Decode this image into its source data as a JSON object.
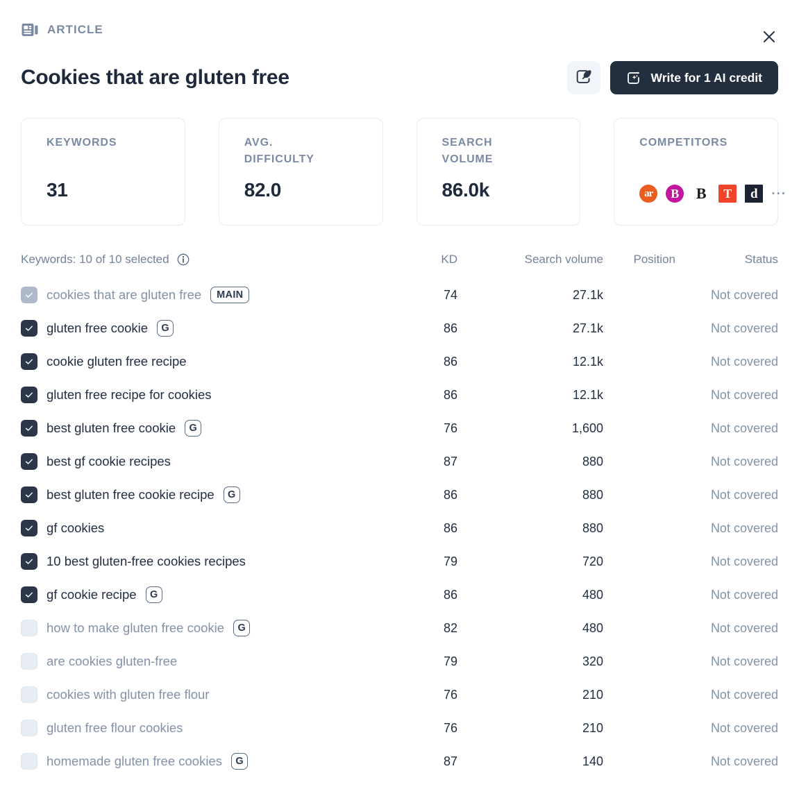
{
  "header": {
    "eyebrow_label": "ARTICLE",
    "eyebrow_icon": "article-icon",
    "close_icon": "close-icon",
    "title": "Cookies that are gluten free"
  },
  "actions": {
    "edit_icon": "quill-pen-icon",
    "ai_icon": "ai-sparkle-icon",
    "write_label": "Write for 1 AI credit"
  },
  "stats": [
    {
      "label": "KEYWORDS",
      "value": "31"
    },
    {
      "label": "AVG. DIFFICULTY",
      "value": "82.0"
    },
    {
      "label": "SEARCH VOLUME",
      "value": "86.0k"
    }
  ],
  "competitors": {
    "label": "COMPETITORS",
    "items": [
      {
        "name": "allrecipes-favicon",
        "text": "ar",
        "class": "fav-ar"
      },
      {
        "name": "bettycrocker-favicon",
        "text": "B",
        "class": "fav-b1"
      },
      {
        "name": "bonappetit-favicon",
        "text": "B",
        "class": "fav-b2"
      },
      {
        "name": "nytimes-favicon",
        "text": "T",
        "class": "fav-t"
      },
      {
        "name": "delish-favicon",
        "text": "d",
        "class": "fav-d"
      }
    ],
    "more": "···"
  },
  "table": {
    "summary": "Keywords: 10 of 10 selected",
    "info_icon": "info-icon",
    "columns": {
      "kd": "KD",
      "volume": "Search volume",
      "position": "Position",
      "status": "Status"
    },
    "rows": [
      {
        "keyword": "cookies that are gluten free",
        "badge": "MAIN",
        "badge_type": "main",
        "checked": true,
        "disabled": true,
        "kd": "74",
        "volume": "27.1k",
        "position": "",
        "status": "Not covered"
      },
      {
        "keyword": "gluten free cookie",
        "badge": "G",
        "badge_type": "g",
        "checked": true,
        "disabled": false,
        "kd": "86",
        "volume": "27.1k",
        "position": "",
        "status": "Not covered"
      },
      {
        "keyword": "cookie gluten free recipe",
        "badge": "",
        "badge_type": "",
        "checked": true,
        "disabled": false,
        "kd": "86",
        "volume": "12.1k",
        "position": "",
        "status": "Not covered"
      },
      {
        "keyword": "gluten free recipe for cookies",
        "badge": "",
        "badge_type": "",
        "checked": true,
        "disabled": false,
        "kd": "86",
        "volume": "12.1k",
        "position": "",
        "status": "Not covered"
      },
      {
        "keyword": "best gluten free cookie",
        "badge": "G",
        "badge_type": "g",
        "checked": true,
        "disabled": false,
        "kd": "76",
        "volume": "1,600",
        "position": "",
        "status": "Not covered"
      },
      {
        "keyword": "best gf cookie recipes",
        "badge": "",
        "badge_type": "",
        "checked": true,
        "disabled": false,
        "kd": "87",
        "volume": "880",
        "position": "",
        "status": "Not covered"
      },
      {
        "keyword": "best gluten free cookie recipe",
        "badge": "G",
        "badge_type": "g",
        "checked": true,
        "disabled": false,
        "kd": "86",
        "volume": "880",
        "position": "",
        "status": "Not covered"
      },
      {
        "keyword": "gf cookies",
        "badge": "",
        "badge_type": "",
        "checked": true,
        "disabled": false,
        "kd": "86",
        "volume": "880",
        "position": "",
        "status": "Not covered"
      },
      {
        "keyword": "10 best gluten-free cookies recipes",
        "badge": "",
        "badge_type": "",
        "checked": true,
        "disabled": false,
        "kd": "79",
        "volume": "720",
        "position": "",
        "status": "Not covered"
      },
      {
        "keyword": "gf cookie recipe",
        "badge": "G",
        "badge_type": "g",
        "checked": true,
        "disabled": false,
        "kd": "86",
        "volume": "480",
        "position": "",
        "status": "Not covered"
      },
      {
        "keyword": "how to make gluten free cookie",
        "badge": "G",
        "badge_type": "g",
        "checked": false,
        "disabled": false,
        "kd": "82",
        "volume": "480",
        "position": "",
        "status": "Not covered"
      },
      {
        "keyword": "are cookies gluten-free",
        "badge": "",
        "badge_type": "",
        "checked": false,
        "disabled": false,
        "kd": "79",
        "volume": "320",
        "position": "",
        "status": "Not covered"
      },
      {
        "keyword": "cookies with gluten free flour",
        "badge": "",
        "badge_type": "",
        "checked": false,
        "disabled": false,
        "kd": "76",
        "volume": "210",
        "position": "",
        "status": "Not covered"
      },
      {
        "keyword": "gluten free flour cookies",
        "badge": "",
        "badge_type": "",
        "checked": false,
        "disabled": false,
        "kd": "76",
        "volume": "210",
        "position": "",
        "status": "Not covered"
      },
      {
        "keyword": "homemade gluten free cookies",
        "badge": "G",
        "badge_type": "g",
        "checked": false,
        "disabled": false,
        "kd": "87",
        "volume": "140",
        "position": "",
        "status": "Not covered"
      }
    ]
  },
  "colors": {
    "dark": "#232f3e",
    "muted": "#74839a",
    "border": "#e6ecf2"
  }
}
